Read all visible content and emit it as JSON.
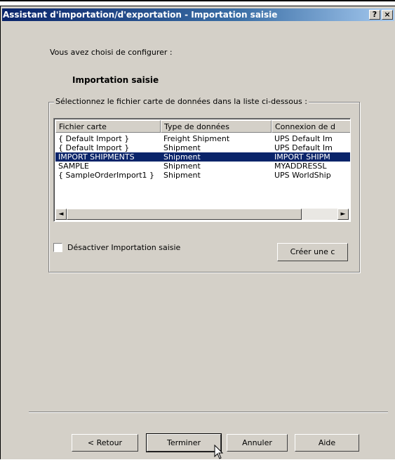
{
  "window": {
    "title": "Assistant d'importation/d'exportation - Importation saisie",
    "help_button": "?",
    "close_button": "×"
  },
  "intro_text": "Vous avez choisi de configurer :",
  "selected_config": "Importation saisie",
  "group": {
    "label": "Sélectionnez le fichier carte de données dans la liste ci-dessous :",
    "columns": [
      "Fichier carte",
      "Type de données",
      "Connexion de d"
    ],
    "rows": [
      {
        "cells": [
          "{ Default Import }",
          "Freight Shipment",
          "UPS Default Im"
        ],
        "selected": false
      },
      {
        "cells": [
          "{ Default Import }",
          "Shipment",
          "UPS Default Im"
        ],
        "selected": false
      },
      {
        "cells": [
          "IMPORT SHIPMENTS",
          "Shipment",
          "IMPORT SHIPM"
        ],
        "selected": true
      },
      {
        "cells": [
          "SAMPLE",
          "Shipment",
          "MYADDRESSL"
        ],
        "selected": false
      },
      {
        "cells": [
          "{ SampleOrderImport1 }",
          "Shipment",
          "UPS WorldShip"
        ],
        "selected": false
      }
    ],
    "scroll_left_glyph": "◄",
    "scroll_right_glyph": "►"
  },
  "disable_checkbox": {
    "label": "Désactiver Importation saisie",
    "checked": false
  },
  "create_button": "Créer une c",
  "buttons": {
    "back": "< Retour",
    "finish": "Terminer",
    "cancel": "Annuler",
    "help": "Aide"
  },
  "colors": {
    "selection": "#0a246a",
    "dialog_face": "#d4d0c8"
  }
}
